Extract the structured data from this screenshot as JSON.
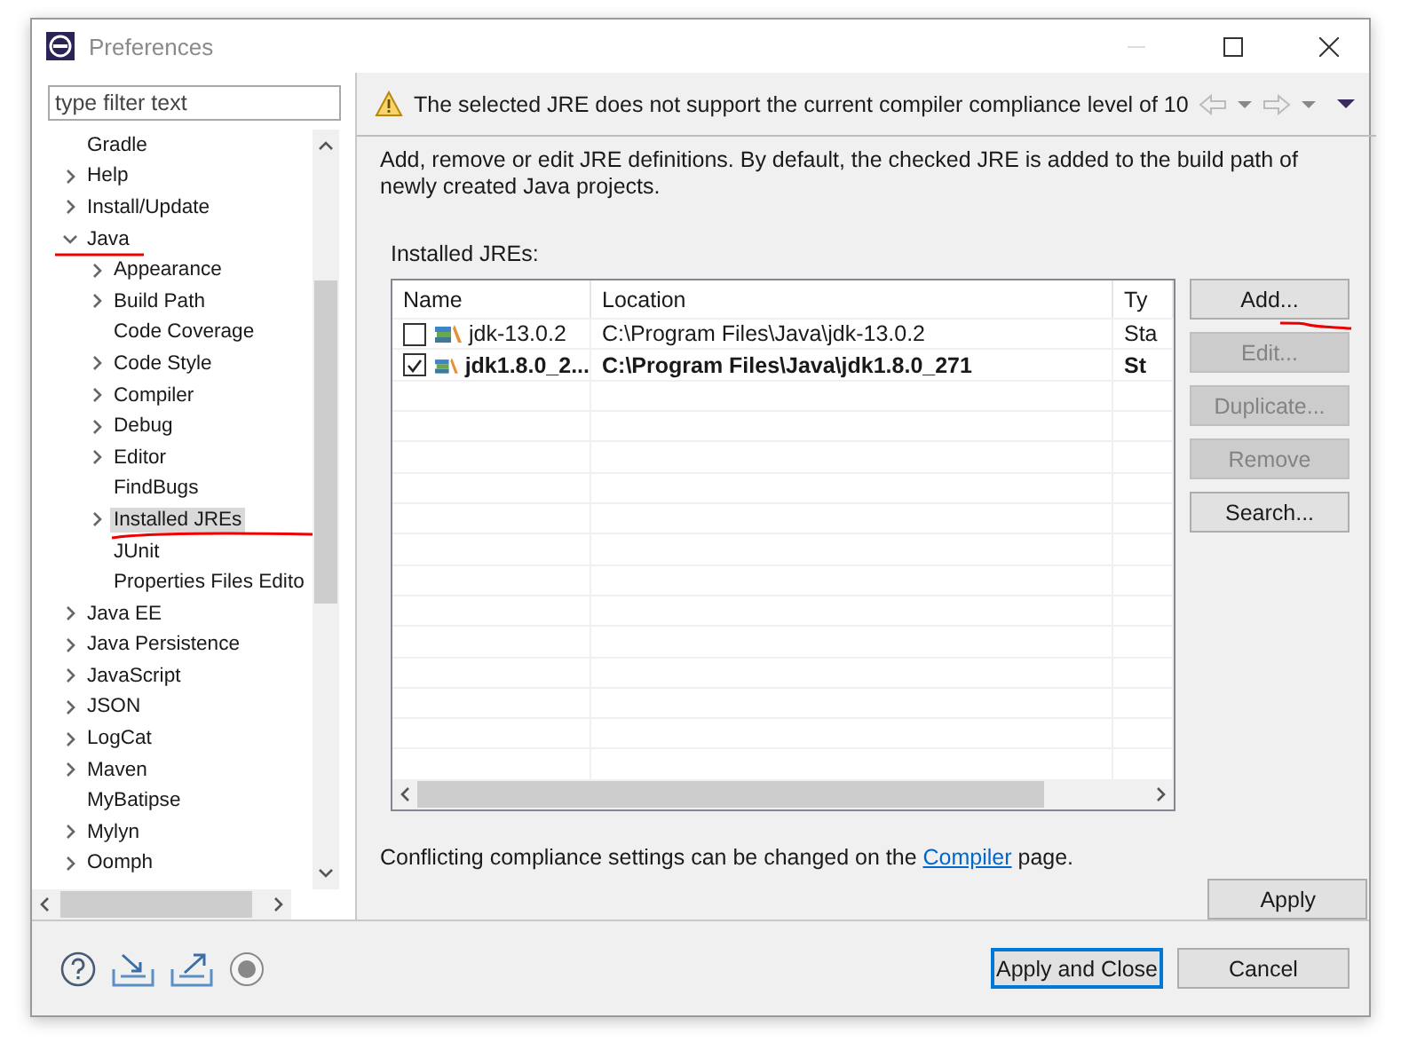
{
  "window": {
    "title": "Preferences"
  },
  "filter": {
    "placeholder": "type filter text"
  },
  "tree": [
    {
      "label": "Gradle",
      "expandable": false,
      "expanded": false,
      "selected": false
    },
    {
      "label": "Help",
      "expandable": true,
      "expanded": false,
      "selected": false
    },
    {
      "label": "Install/Update",
      "expandable": true,
      "expanded": false,
      "selected": false
    },
    {
      "label": "Java",
      "expandable": true,
      "expanded": true,
      "selected": false,
      "children": [
        {
          "label": "Appearance",
          "expandable": true,
          "expanded": false,
          "selected": false
        },
        {
          "label": "Build Path",
          "expandable": true,
          "expanded": false,
          "selected": false
        },
        {
          "label": "Code Coverage",
          "expandable": false,
          "expanded": false,
          "selected": false
        },
        {
          "label": "Code Style",
          "expandable": true,
          "expanded": false,
          "selected": false
        },
        {
          "label": "Compiler",
          "expandable": true,
          "expanded": false,
          "selected": false
        },
        {
          "label": "Debug",
          "expandable": true,
          "expanded": false,
          "selected": false
        },
        {
          "label": "Editor",
          "expandable": true,
          "expanded": false,
          "selected": false
        },
        {
          "label": "FindBugs",
          "expandable": false,
          "expanded": false,
          "selected": false
        },
        {
          "label": "Installed JREs",
          "expandable": true,
          "expanded": false,
          "selected": true
        },
        {
          "label": "JUnit",
          "expandable": false,
          "expanded": false,
          "selected": false
        },
        {
          "label": "Properties Files Edito",
          "expandable": false,
          "expanded": false,
          "selected": false
        }
      ]
    },
    {
      "label": "Java EE",
      "expandable": true,
      "expanded": false,
      "selected": false
    },
    {
      "label": "Java Persistence",
      "expandable": true,
      "expanded": false,
      "selected": false
    },
    {
      "label": "JavaScript",
      "expandable": true,
      "expanded": false,
      "selected": false
    },
    {
      "label": "JSON",
      "expandable": true,
      "expanded": false,
      "selected": false
    },
    {
      "label": "LogCat",
      "expandable": true,
      "expanded": false,
      "selected": false
    },
    {
      "label": "Maven",
      "expandable": true,
      "expanded": false,
      "selected": false
    },
    {
      "label": "MyBatipse",
      "expandable": false,
      "expanded": false,
      "selected": false
    },
    {
      "label": "Mylyn",
      "expandable": true,
      "expanded": false,
      "selected": false
    },
    {
      "label": "Oomph",
      "expandable": true,
      "expanded": false,
      "selected": false
    }
  ],
  "message": {
    "text": "The selected JRE does not support the current compiler compliance level of 10"
  },
  "description": "Add, remove or edit JRE definitions. By default, the checked JRE is added to the build path of newly created Java projects.",
  "table": {
    "label": "Installed JREs:",
    "columns": [
      "Name",
      "Location",
      "Ty"
    ],
    "rows": [
      {
        "name": "jdk-13.0.2",
        "location": "C:\\Program Files\\Java\\jdk-13.0.2",
        "type": "Sta",
        "checked": false
      },
      {
        "name": "jdk1.8.0_2...",
        "location": "C:\\Program Files\\Java\\jdk1.8.0_271",
        "type": "St",
        "checked": true
      }
    ]
  },
  "side_buttons": [
    {
      "label": "Add...",
      "disabled": false
    },
    {
      "label": "Edit...",
      "disabled": true
    },
    {
      "label": "Duplicate...",
      "disabled": true
    },
    {
      "label": "Remove",
      "disabled": true
    },
    {
      "label": "Search...",
      "disabled": false
    }
  ],
  "footer_note": {
    "before": "Conflicting compliance settings can be changed on the ",
    "link": "Compiler",
    "after": " page."
  },
  "apply": "Apply",
  "dialog_buttons": [
    {
      "label": "Apply and Close",
      "default": true
    },
    {
      "label": "Cancel",
      "default": false
    }
  ]
}
